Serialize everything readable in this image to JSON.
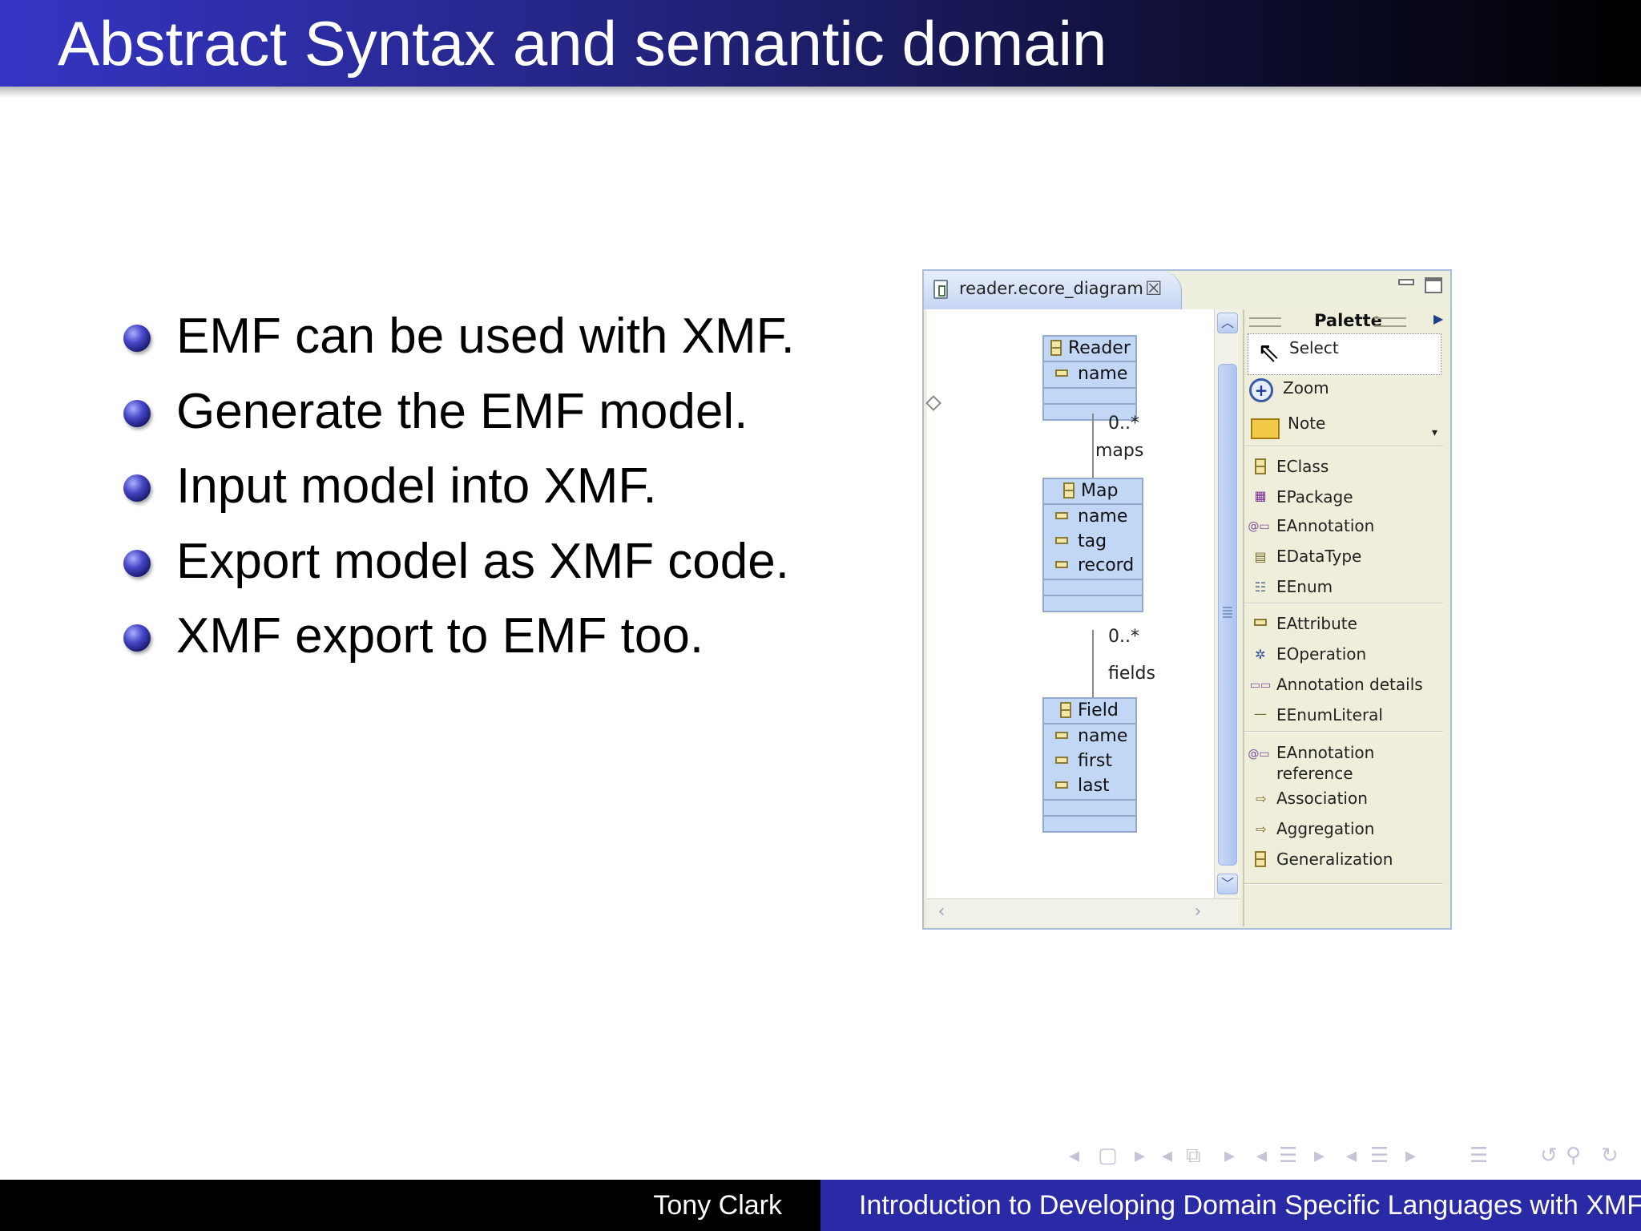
{
  "slide": {
    "title": "Abstract Syntax and semantic domain",
    "bullets": [
      "EMF can be used with XMF.",
      "Generate the EMF model.",
      "Input model into XMF.",
      "Export model as XMF code.",
      "XMF export to EMF too."
    ]
  },
  "editor": {
    "tab_label": "reader.ecore_diagram",
    "diagram": {
      "classes": [
        {
          "name": "Reader",
          "attributes": [
            "name"
          ]
        },
        {
          "name": "Map",
          "attributes": [
            "name",
            "tag",
            "record"
          ]
        },
        {
          "name": "Field",
          "attributes": [
            "name",
            "first",
            "last"
          ]
        }
      ],
      "links": [
        {
          "multiplicity": "0..*",
          "role": "maps"
        },
        {
          "multiplicity": "0..*",
          "role": "fields"
        }
      ]
    },
    "palette": {
      "title": "Palette",
      "tools": [
        "Select",
        "Zoom",
        "Note"
      ],
      "group1": [
        "EClass",
        "EPackage",
        "EAnnotation",
        "EDataType",
        "EEnum"
      ],
      "group2": [
        "EAttribute",
        "EOperation",
        "Annotation details",
        "EEnumLiteral"
      ],
      "group3": [
        "EAnnotation\nreference",
        "Association",
        "Aggregation",
        "Generalization"
      ]
    }
  },
  "footer": {
    "author": "Tony Clark",
    "title": "Introduction to Developing Domain Specific Languages with XMF"
  },
  "icons": {
    "bullet": "ball-bullet-icon",
    "tab": "ecore-diagram-file-icon",
    "close": "close-icon",
    "select": "arrow-cursor-icon",
    "zoom": "zoom-icon",
    "note": "note-icon"
  },
  "colors": {
    "title_bar_start": "#3535c4",
    "title_bar_end": "#000000",
    "footer_right": "#2a2aa6",
    "class_fill": "#c2d6f6"
  }
}
